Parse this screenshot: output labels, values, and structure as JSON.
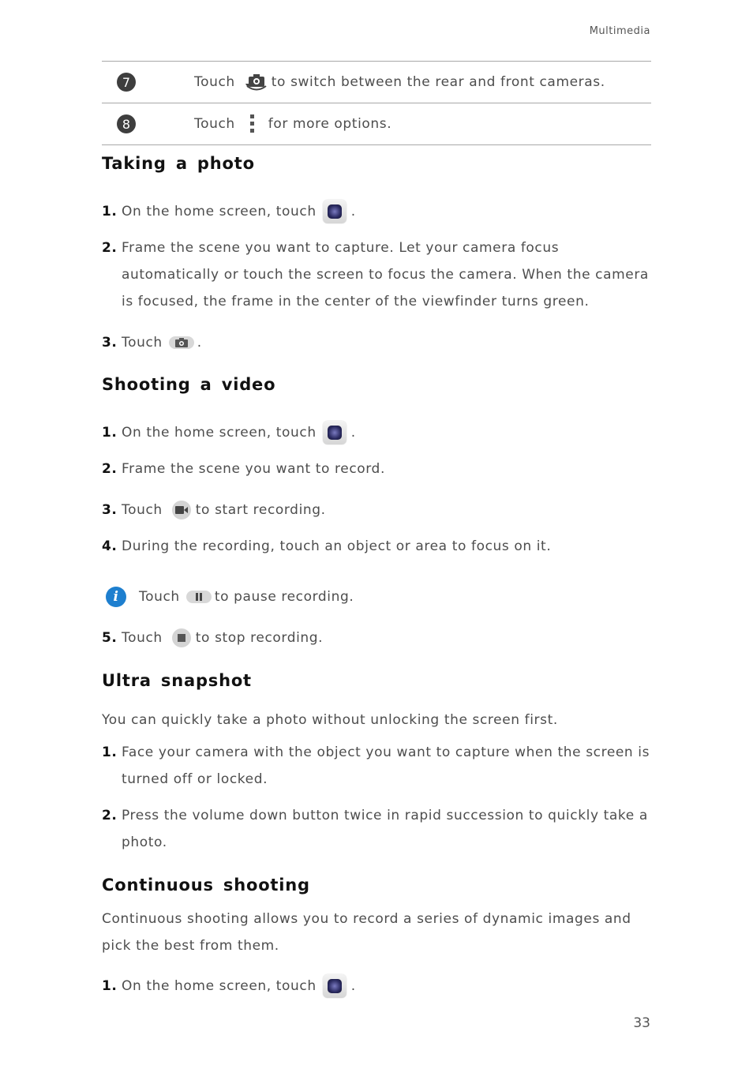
{
  "header": {
    "section": "Multimedia"
  },
  "page_number": "33",
  "table": {
    "rows": [
      {
        "num": "7",
        "pre": "Touch",
        "icon": "switch-camera-icon",
        "post": "to switch between the rear and front cameras."
      },
      {
        "num": "8",
        "pre": "Touch",
        "icon": "more-options-icon",
        "post": "for more options."
      }
    ]
  },
  "sections": {
    "photo": {
      "title": "Taking  a  photo",
      "steps": [
        {
          "n": "1.",
          "pre": "On the home screen, touch",
          "icon": "camera-app-icon",
          "post": "."
        },
        {
          "n": "2.",
          "text": "Frame the scene you want to capture. Let your camera focus automatically or touch the screen to focus the camera. When the camera is focused, the frame in the center of the viewfinder turns green."
        },
        {
          "n": "3.",
          "pre": "Touch",
          "icon": "shutter-icon",
          "post": "."
        }
      ]
    },
    "video": {
      "title": "Shooting  a  video",
      "steps": [
        {
          "n": "1.",
          "pre": "On the home screen, touch",
          "icon": "camera-app-icon",
          "post": "."
        },
        {
          "n": "2.",
          "text": "Frame the scene you want to record."
        },
        {
          "n": "3.",
          "pre": "Touch",
          "icon": "record-icon",
          "post": "to start recording."
        },
        {
          "n": "4.",
          "text": "During the recording, touch an object or area to focus on it."
        },
        {
          "n": "5.",
          "pre": "Touch",
          "icon": "stop-icon",
          "post": "to stop recording."
        }
      ],
      "note": {
        "icon": "info-icon",
        "pre": "Touch",
        "btn_icon": "pause-icon",
        "post": "to pause recording."
      }
    },
    "ultra": {
      "title": "Ultra  snapshot",
      "intro": "You can quickly take a photo without unlocking the screen first.",
      "steps": [
        {
          "n": "1.",
          "text": "Face your camera with the object you want to capture when the screen is turned off or locked."
        },
        {
          "n": "2.",
          "text": "Press the volume down button twice in rapid succession to quickly take a photo."
        }
      ]
    },
    "continuous": {
      "title": "Continuous  shooting",
      "intro": "Continuous shooting allows you to record a series of dynamic images and pick the best from them.",
      "steps": [
        {
          "n": "1.",
          "pre": "On the home screen, touch",
          "icon": "camera-app-icon",
          "post": "."
        }
      ]
    }
  },
  "colors": {
    "info_blue": "#1e7fcf",
    "badge": "#3e3e3e",
    "rule": "#a8a8a8"
  }
}
